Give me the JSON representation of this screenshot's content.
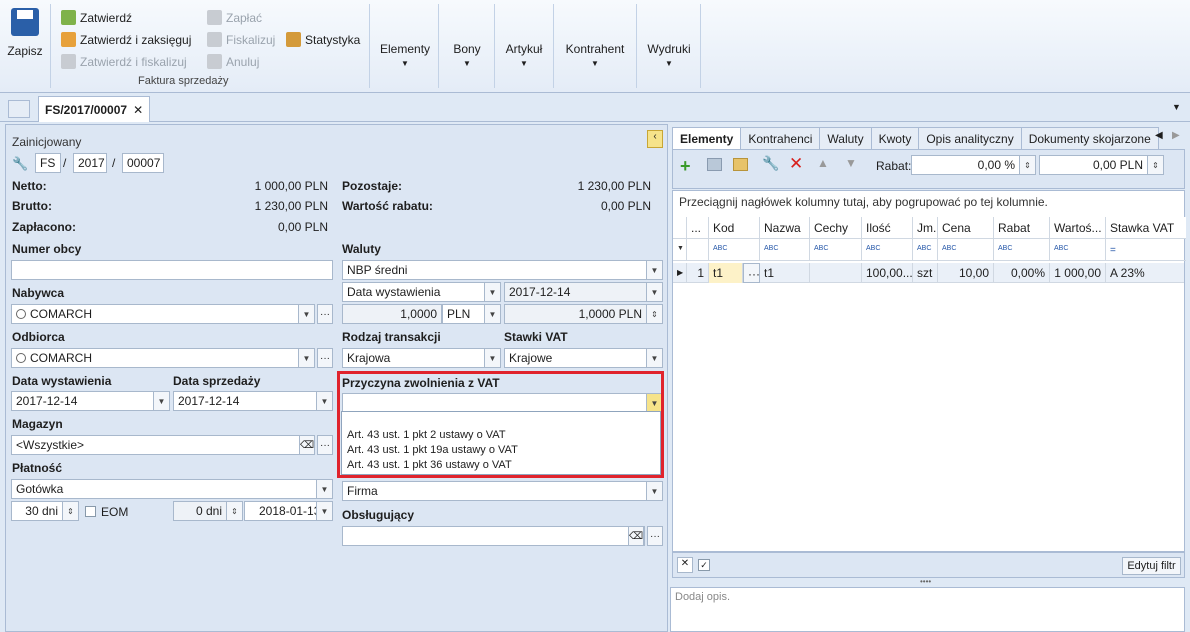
{
  "ribbon": {
    "save": "Zapisz",
    "approve": "Zatwierdź",
    "approve_post": "Zatwierdź i zaksięguj",
    "approve_fiscal": "Zatwierdź i fiskalizuj",
    "pay": "Zapłać",
    "fiscalize": "Fiskalizuj",
    "cancel": "Anuluj",
    "stats": "Statystyka",
    "group": "Faktura sprzedaży",
    "elements": "Elementy",
    "vouchers": "Bony",
    "article": "Artykuł",
    "contractor": "Kontrahent",
    "prints": "Wydruki"
  },
  "tab": {
    "title": "FS/2017/00007"
  },
  "doc": {
    "status": "Zainicjowany",
    "series": "FS",
    "year": "2017",
    "number": "00007",
    "netto_l": "Netto:",
    "netto": "1 000,00 PLN",
    "brutto_l": "Brutto:",
    "brutto": "1 230,00 PLN",
    "paid_l": "Zapłacono:",
    "paid": "0,00 PLN",
    "remaining_l": "Pozostaje:",
    "remaining": "1 230,00 PLN",
    "discount_l": "Wartość rabatu:",
    "discount": "0,00 PLN"
  },
  "form": {
    "foreign_no": "Numer obcy",
    "buyer": "Nabywca",
    "buyer_v": "COMARCH",
    "recipient": "Odbiorca",
    "recipient_v": "COMARCH",
    "issue_date": "Data wystawienia",
    "issue_date_v": "2017-12-14",
    "sale_date": "Data sprzedaży",
    "sale_date_v": "2017-12-14",
    "warehouse": "Magazyn",
    "warehouse_v": "<Wszystkie>",
    "payment": "Płatność",
    "payment_v": "Gotówka",
    "days": "30 dni",
    "eom": "EOM",
    "days0": "0 dni",
    "due": "2018-01-13",
    "currencies": "Waluty",
    "rate_src": "NBP średni",
    "rate_basis": "Data wystawienia",
    "rate_date": "2017-12-14",
    "rate1": "1,0000",
    "cur": "PLN",
    "rate2": "1,0000 PLN",
    "trans_type": "Rodzaj transakcji",
    "trans_v": "Krajowa",
    "vat_rates": "Stawki VAT",
    "vat_v": "Krajowe",
    "vat_exempt": "Przyczyna zwolnienia z VAT",
    "status_v": "Firma",
    "handler": "Obsługujący"
  },
  "popup": [
    "Art. 43 ust. 1 pkt 2 ustawy o VAT",
    "Art. 43 ust. 1 pkt 19a ustawy o VAT",
    "Art. 43 ust. 1 pkt 36 ustawy o VAT"
  ],
  "rtabs": [
    "Elementy",
    "Kontrahenci",
    "Waluty",
    "Kwoty",
    "Opis analityczny",
    "Dokumenty skojarzone"
  ],
  "toolbar": {
    "rabat": "Rabat:",
    "pct": "0,00 %",
    "pln": "0,00 PLN"
  },
  "grid": {
    "group_hint": "Przeciągnij nagłówek kolumny tutaj, aby pogrupować po tej kolumnie.",
    "headers": [
      "...",
      "Kod",
      "Nazwa",
      "Cechy",
      "Ilość",
      "Jm.",
      "Cena",
      "Rabat",
      "Wartoś...",
      "Stawka VAT"
    ],
    "row": [
      "1",
      "t1",
      "t1",
      "",
      "100,00...",
      "szt",
      "10,00",
      "0,00%",
      "1 000,00",
      "A 23%"
    ],
    "edit_filter": "Edytuj filtr"
  },
  "desc_placeholder": "Dodaj opis."
}
